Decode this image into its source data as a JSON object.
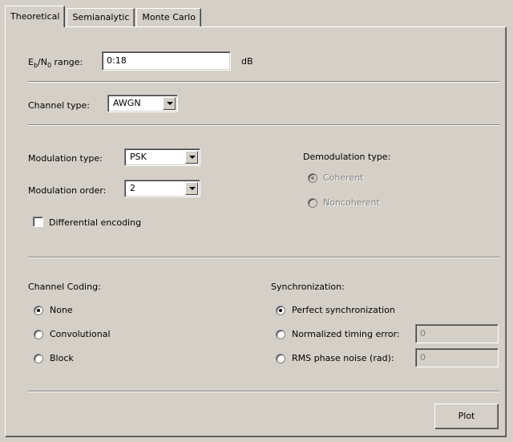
{
  "tabs": [
    {
      "label": "Theoretical",
      "active": true
    },
    {
      "label": "Semianalytic",
      "active": false
    },
    {
      "label": "Monte Carlo",
      "active": false
    }
  ],
  "ebno": {
    "label_main_e": "E",
    "label_sub_b": "b",
    "label_slash": "/N",
    "label_sub_0": "0",
    "label_rest": " range:",
    "value": "0:18",
    "unit": "dB"
  },
  "channel_type": {
    "label": "Channel type:",
    "value": "AWGN"
  },
  "modulation": {
    "type_label": "Modulation type:",
    "type_value": "PSK",
    "order_label": "Modulation order:",
    "order_value": "2",
    "differential_label": "Differential encoding",
    "differential_checked": false
  },
  "demodulation": {
    "label": "Demodulation type:",
    "options": [
      {
        "label": "Coherent",
        "selected": true,
        "disabled": true
      },
      {
        "label": "Noncoherent",
        "selected": false,
        "disabled": true
      }
    ]
  },
  "channel_coding": {
    "label": "Channel Coding:",
    "options": [
      {
        "label": "None",
        "selected": true
      },
      {
        "label": "Convolutional",
        "selected": false
      },
      {
        "label": "Block",
        "selected": false
      }
    ]
  },
  "synchronization": {
    "label": "Synchronization:",
    "options": [
      {
        "label": "Perfect synchronization",
        "selected": true
      },
      {
        "label": "Normalized timing error:",
        "selected": false,
        "field_value": "0"
      },
      {
        "label": "RMS phase noise (rad):",
        "selected": false,
        "field_value": "0"
      }
    ]
  },
  "plot_button": "Plot"
}
